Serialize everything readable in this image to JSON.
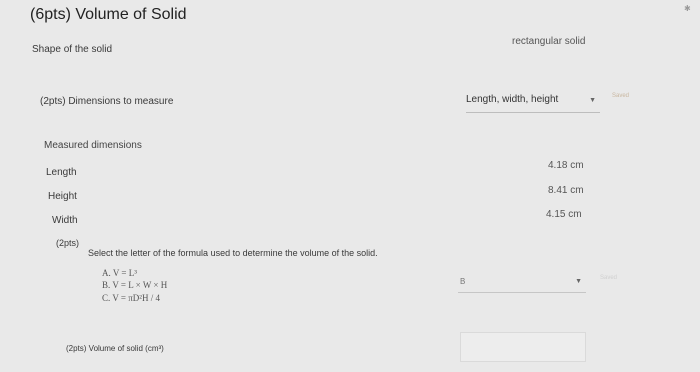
{
  "title": "(6pts) Volume of Solid",
  "shape": {
    "label": "Shape of the solid",
    "value": "rectangular solid"
  },
  "dimensions": {
    "label": "(2pts)  Dimensions to measure",
    "selected": "Length, width, height",
    "saved": "Saved"
  },
  "measured": {
    "heading": "Measured dimensions",
    "rows": [
      {
        "label": "Length",
        "value": "4.18 cm"
      },
      {
        "label": "Height",
        "value": "8.41 cm"
      },
      {
        "label": "Width",
        "value": "4.15 cm"
      }
    ]
  },
  "formula_q": {
    "pts": "(2pts)",
    "prompt": "Select the letter of the formula used to determine the volume of the solid.",
    "options": [
      "A. V = L³",
      "B. V = L × W × H",
      "C. V = πD²H / 4"
    ],
    "selected": "B",
    "saved": "Saved"
  },
  "volume_q": {
    "label": "(2pts)  Volume of solid (cm³)"
  },
  "icons": {
    "corner": "settings-icon",
    "dropdown": "chevron-down-icon"
  }
}
